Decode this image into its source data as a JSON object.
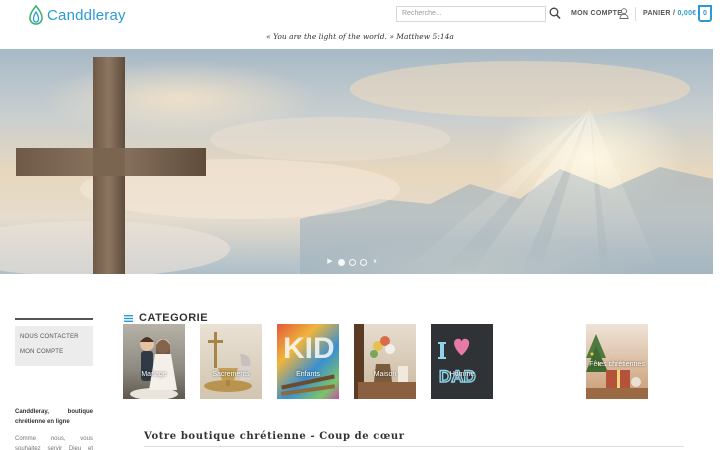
{
  "header": {
    "brand": "Canddleray",
    "search_placeholder": "Recherche...",
    "account_label": "MON COMPTE",
    "cart_label": "PANIER /",
    "cart_amount": "0,00€",
    "cart_count": "0",
    "quote": "« You are the light of the world. » Matthew 5:14a"
  },
  "hero": {
    "slides": 3,
    "active_slide": 1
  },
  "sidebar": {
    "links": [
      "NOUS CONTACTER",
      "MON COMPTE"
    ],
    "about_title": "Canddleray, boutique chrétienne en ligne",
    "about_text": "Comme nous, vous souhaitez servir Dieu et témoigner des"
  },
  "categories": {
    "title": "CATEGORIE",
    "items": [
      {
        "label": "Mariage"
      },
      {
        "label": "Sacrements"
      },
      {
        "label": "Enfants"
      },
      {
        "label": "Maison"
      },
      {
        "label": "Homme"
      },
      {
        "label": "Fêtes chrétiennes"
      }
    ]
  },
  "section": {
    "title": "Votre boutique chrétienne - Coup de cœur"
  },
  "colors": {
    "accent": "#2a9ad6"
  },
  "icons": [
    "logo-icon",
    "search-icon",
    "user-icon",
    "menu-icon",
    "play-icon",
    "pause-icon"
  ]
}
